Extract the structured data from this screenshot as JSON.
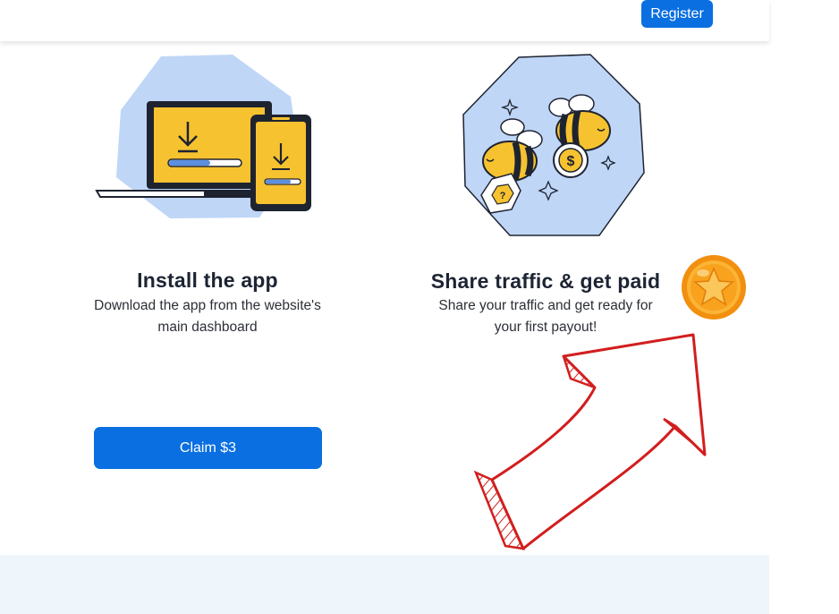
{
  "header": {
    "register_label": "Register"
  },
  "cards": [
    {
      "title": "Install the app",
      "description_line1": "Download the app from the website's",
      "description_line2": "main dashboard"
    },
    {
      "title": "Share traffic & get paid",
      "description_line1": "Share your traffic and get ready for",
      "description_line2": "your first payout!"
    }
  ],
  "actions": {
    "claim_label": "Claim $3"
  },
  "icons": {
    "install": "laptop-phone-download-icon",
    "share": "bees-dollar-coin-icon",
    "coin": "gold-star-coin-icon",
    "arrow": "red-hand-drawn-arrow-icon"
  },
  "colors": {
    "primary": "#0a6fe0",
    "illustration_bg": "#bfd6f7",
    "illustration_yellow": "#f6c22f",
    "arrow_red": "#d21e1e",
    "coin_orange": "#f7a21b"
  }
}
